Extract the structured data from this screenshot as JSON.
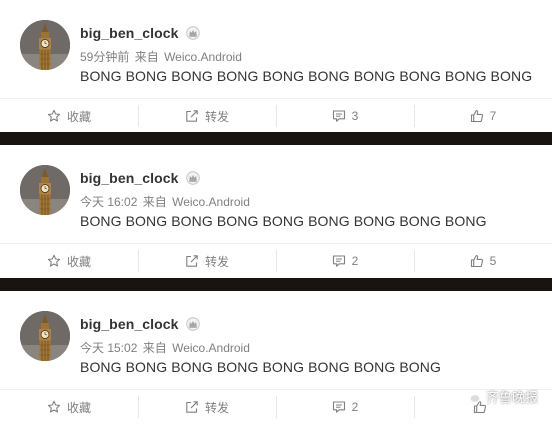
{
  "posts": [
    {
      "username": "big_ben_clock",
      "time": "59分钟前",
      "via": "来自",
      "source": "Weico.Android",
      "text": "BONG BONG BONG BONG BONG BONG BONG BONG BONG BONG",
      "actions": {
        "favorite": "收藏",
        "repost": "转发",
        "comments": "3",
        "likes": "7"
      }
    },
    {
      "username": "big_ben_clock",
      "time": "今天 16:02",
      "via": "来自",
      "source": "Weico.Android",
      "text": "BONG BONG BONG BONG BONG BONG BONG BONG BONG",
      "actions": {
        "favorite": "收藏",
        "repost": "转发",
        "comments": "2",
        "likes": "5"
      }
    },
    {
      "username": "big_ben_clock",
      "time": "今天 15:02",
      "via": "来自",
      "source": "Weico.Android",
      "text": "BONG BONG BONG BONG BONG BONG BONG BONG",
      "actions": {
        "favorite": "收藏",
        "repost": "转发",
        "comments": "2",
        "likes": ""
      }
    }
  ],
  "watermark": {
    "text": "齐鲁晚报",
    "icon": "wechat-icon"
  },
  "icons": {
    "avatar": "big-ben-avatar",
    "badge": "crown-badge-icon",
    "favorite": "star-icon",
    "repost": "share-icon",
    "comment": "comment-icon",
    "like": "thumbs-up-icon"
  },
  "colors": {
    "text": "#333333",
    "meta": "#808080",
    "background": "#ffffff",
    "separator": "#1a1411"
  }
}
